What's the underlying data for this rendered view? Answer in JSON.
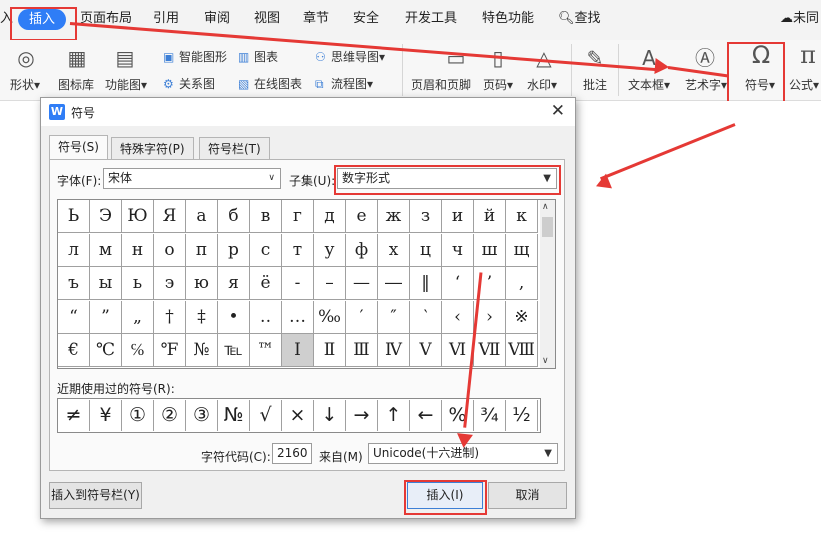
{
  "ribbon": {
    "tabs": [
      "入",
      "插入",
      "页面布局",
      "引用",
      "审阅",
      "视图",
      "章节",
      "安全",
      "开发工具",
      "特色功能",
      "查找",
      "未同"
    ],
    "active_tab": "插入"
  },
  "toolbar": {
    "shapes": "形状",
    "icon_library": "图标库",
    "function_chart": "功能图",
    "smart_shape": "智能图形",
    "chart": "图表",
    "mind_map": "思维导图",
    "relation_chart": "关系图",
    "online_chart": "在线图表",
    "flow_chart": "流程图",
    "header_footer": "页眉和页脚",
    "page_number": "页码",
    "watermark": "水印",
    "comment": "批注",
    "text_box": "文本框",
    "art_text": "艺术字",
    "symbol": "符号",
    "formula": "公式"
  },
  "dialog": {
    "title": "符号",
    "tabs": [
      "符号(S)",
      "特殊字符(P)",
      "符号栏(T)"
    ],
    "font_label": "字体(F):",
    "font_value": "宋体",
    "subset_label": "子集(U):",
    "subset_value": "数字形式",
    "symbols": [
      [
        "Ь",
        "Э",
        "Ю",
        "Я",
        "а",
        "б",
        "в",
        "г",
        "д",
        "е",
        "ж",
        "з",
        "и",
        "й",
        "к"
      ],
      [
        "л",
        "м",
        "н",
        "о",
        "п",
        "р",
        "с",
        "т",
        "у",
        "ф",
        "х",
        "ц",
        "ч",
        "ш",
        "щ"
      ],
      [
        "ъ",
        "ы",
        "ь",
        "э",
        "ю",
        "я",
        "ё",
        "-",
        "–",
        "—",
        "―",
        "‖",
        "‘",
        "’",
        "‚"
      ],
      [
        "“",
        "”",
        "„",
        "†",
        "‡",
        "•",
        "‥",
        "…",
        "‰",
        "′",
        "″",
        "‵",
        "‹",
        "›",
        "※"
      ],
      [
        "€",
        "℃",
        "℅",
        "℉",
        "№",
        "℡",
        "™",
        "Ⅰ",
        "Ⅱ",
        "Ⅲ",
        "Ⅳ",
        "Ⅴ",
        "Ⅵ",
        "Ⅶ",
        "Ⅷ"
      ]
    ],
    "selected_symbol": "Ⅰ",
    "recent_label": "近期使用过的符号(R):",
    "recent": [
      "≠",
      "¥",
      "①",
      "②",
      "③",
      "№",
      "√",
      "×",
      "↓",
      "→",
      "↑",
      "←",
      "%",
      "¾",
      "½"
    ],
    "code_label": "字符代码(C):",
    "code_value": "2160",
    "from_label": "来自(M)",
    "from_value": "Unicode(十六进制)",
    "insert_to_bar": "插入到符号栏(Y)",
    "insert": "插入(I)",
    "cancel": "取消"
  },
  "colors": {
    "accent": "#2f7df6",
    "annotation": "#e53935"
  }
}
